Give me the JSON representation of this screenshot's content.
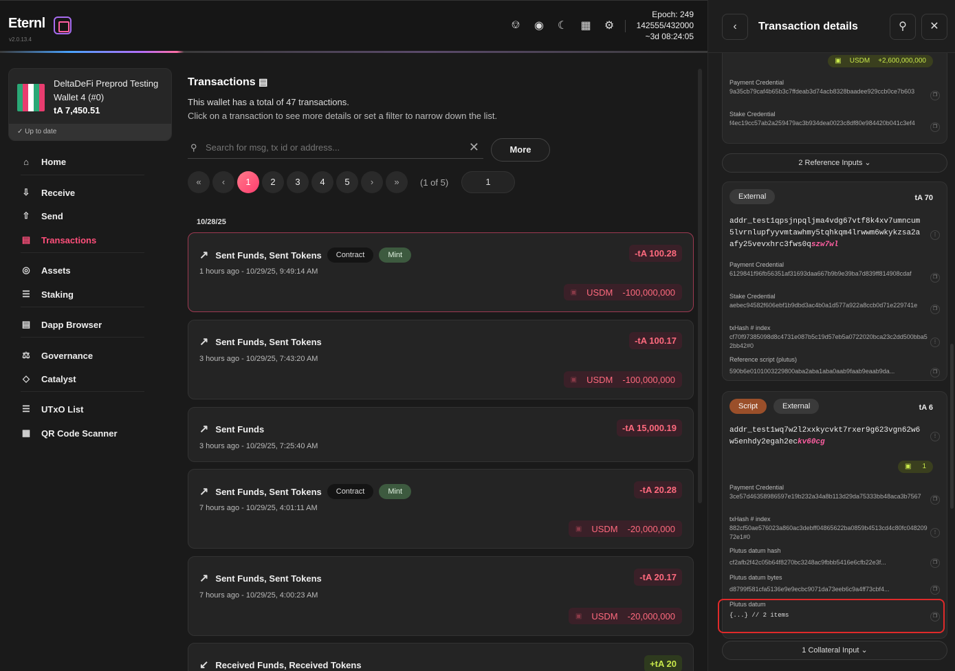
{
  "app": {
    "name": "Eternl",
    "version": "v2.0.13.4"
  },
  "epoch": {
    "line1": "Epoch: 249",
    "line2": "142555/432000",
    "line3": "~3d 08:24:05"
  },
  "wallet": {
    "name": "DeltaDeFi Preprod Testing Wallet 4 (#0)",
    "balance": "tA 7,450.51",
    "status": "Up to date"
  },
  "nav": [
    {
      "label": "Home",
      "icon": "home-icon"
    },
    {
      "label": "Receive",
      "icon": "receive-icon"
    },
    {
      "label": "Send",
      "icon": "send-icon"
    },
    {
      "label": "Transactions",
      "icon": "transactions-icon"
    },
    {
      "label": "Assets",
      "icon": "assets-icon"
    },
    {
      "label": "Staking",
      "icon": "staking-icon"
    },
    {
      "label": "Dapp Browser",
      "icon": "dapp-browser-icon"
    },
    {
      "label": "Governance",
      "icon": "governance-icon"
    },
    {
      "label": "Catalyst",
      "icon": "catalyst-icon"
    },
    {
      "label": "UTxO List",
      "icon": "utxo-list-icon"
    },
    {
      "label": "QR Code Scanner",
      "icon": "qr-scanner-icon"
    }
  ],
  "main": {
    "title": "Transactions",
    "desc1": "This wallet has a total of 47 transactions.",
    "desc2": "Click on a transaction to see more details or set a filter to narrow down the list.",
    "search_placeholder": "Search for msg, tx id or address...",
    "more_label": "More",
    "pages": [
      "1",
      "2",
      "3",
      "4",
      "5"
    ],
    "page_info": "(1 of 5)",
    "page_input": "1",
    "date": "10/28/25"
  },
  "transactions": [
    {
      "title": "Sent Funds, Sent Tokens",
      "tags": [
        "Contract",
        "Mint"
      ],
      "time": "1 hours ago - 10/29/25, 9:49:14 AM",
      "amount": "-tA 100.28",
      "token": "USDM",
      "token_amount": "-100,000,000"
    },
    {
      "title": "Sent Funds, Sent Tokens",
      "tags": [],
      "time": "3 hours ago - 10/29/25, 7:43:20 AM",
      "amount": "-tA 100.17",
      "token": "USDM",
      "token_amount": "-100,000,000"
    },
    {
      "title": "Sent Funds",
      "tags": [],
      "time": "3 hours ago - 10/29/25, 7:25:40 AM",
      "amount": "-tA 15,000.19",
      "token": "",
      "token_amount": ""
    },
    {
      "title": "Sent Funds, Sent Tokens",
      "tags": [
        "Contract",
        "Mint"
      ],
      "time": "7 hours ago - 10/29/25, 4:01:11 AM",
      "amount": "-tA 20.28",
      "token": "USDM",
      "token_amount": "-20,000,000"
    },
    {
      "title": "Sent Funds, Sent Tokens",
      "tags": [],
      "time": "7 hours ago - 10/29/25, 4:00:23 AM",
      "amount": "-tA 20.17",
      "token": "USDM",
      "token_amount": "-20,000,000"
    },
    {
      "title": "Received Funds, Received Tokens",
      "tags": [],
      "time": "",
      "amount": "+tA 20",
      "token": "",
      "token_amount": ""
    }
  ],
  "panel": {
    "title": "Transaction details",
    "top_token": "USDM",
    "top_token_amount": "+2,600,000,000",
    "top_payment_label": "Payment Credential",
    "top_payment": "9a35cb79caf4b65b3c7ffdeab3d74acb8328baadee929ccb0ce7b603",
    "top_stake_label": "Stake Credential",
    "top_stake": "f4ec19cc57ab2a259479ac3b934dea0023c8df80e984420b041c3ef4",
    "ref_inputs": "2  Reference Inputs",
    "in1": {
      "tag": "External",
      "amount": "tA 70",
      "addr": "addr_test1qpsjnpqljma4vdg67vtf8k4xv7umncum5lvrnlupfyyvmtawhmy5tqhkqm4lrwwm6wkykzsa2aafy25vevxhrc3fws0q",
      "addr_tail": "szw7wl",
      "payment_label": "Payment Credential",
      "payment": "6129841f96fb56351af31693daa667b9b9e39ba7d839ff814908cdaf",
      "stake_label": "Stake Credential",
      "stake": "aebec94582f606ebf1b9dbd3ac4b0a1d577a922a8ccb0d71e229741e",
      "txhash_label": "txHash # index",
      "txhash": "cf70f97385098d8c4731e087b5c19d57eb5a0722020bca23c2dd500bba52bb42#0",
      "ref_label": "Reference script (plutus)",
      "ref": "590b6e0101003229800aba2aba1aba0aab9faab9eaab9da..."
    },
    "in2": {
      "tag1": "Script",
      "tag2": "External",
      "amount": "tA 6",
      "addr": "addr_test1wq7w2l2xxkycvkt7rxer9g623vgn62w6w5enhdy2egah2ec",
      "addr_tail": "kv60cg",
      "token_count": "1",
      "payment_label": "Payment Credential",
      "payment": "3ce57d46358986597e19b232a34a8b113d29da75333bb48aca3b7567",
      "txhash_label": "txHash # index",
      "txhash": "882cf50ae576023a860ac3debff04865622ba0859b4513cd4c80fc04820972e1#0",
      "dhash_label": "Plutus datum hash",
      "dhash": "cf2afb2f42c05b64f8270bc3248ac9fbbb5416e6cfb22e3f...",
      "dbytes_label": "Plutus datum bytes",
      "dbytes": "d8799f581cfa5136e9e9ecbc9071da73eeb6c9a4ff73cbf4...",
      "datum_label": "Plutus datum",
      "datum": "{...} // 2 items"
    },
    "collateral": "1  Collateral Input"
  }
}
